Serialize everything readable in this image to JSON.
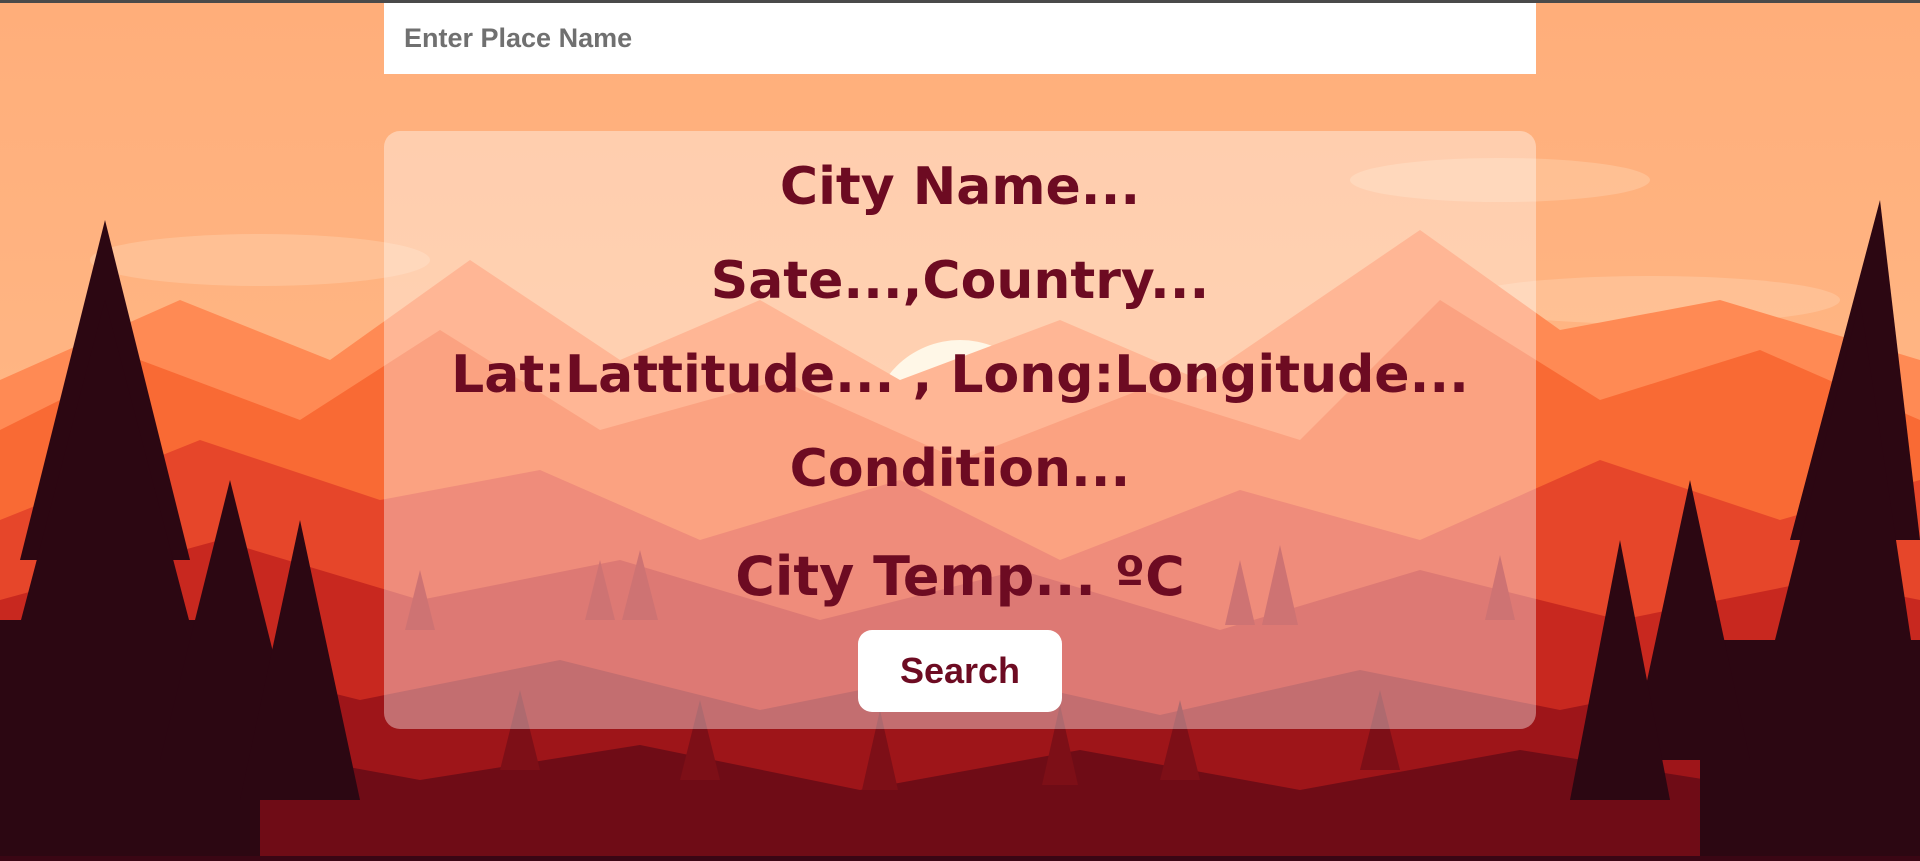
{
  "search": {
    "placeholder": "Enter Place Name",
    "button_label": "Search"
  },
  "weather": {
    "city": "City Name...",
    "region": "Sate...,Country...",
    "coords": "Lat:Lattitude... , Long:Longitude...",
    "condition": "Condition...",
    "temperature": "City Temp... ºC"
  },
  "colors": {
    "text": "#6d0b22",
    "sky": "#ffb07c",
    "card": "rgba(255,255,255,0.38)"
  }
}
